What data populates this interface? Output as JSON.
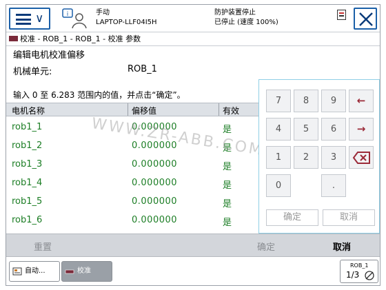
{
  "header": {
    "mode": "手动",
    "controller": "LAPTOP-LLF04I5H",
    "safety_status": "防护装置停止",
    "motor_status": "已停止 (速度 100%)"
  },
  "breadcrumb": "校准 - ROB_1 - ROB_1 - 校准 参数",
  "page": {
    "title": "编辑电机校准偏移",
    "mech_unit_label": "机械单元:",
    "mech_unit_value": "ROB_1",
    "instruction": "输入 0 至 6.283 范围内的值，并点击“确定”。"
  },
  "table": {
    "columns": [
      "电机名称",
      "偏移值",
      "有效"
    ],
    "rows": [
      {
        "name": "rob1_1",
        "offset": "0.000000",
        "valid": "是"
      },
      {
        "name": "rob1_2",
        "offset": "0.000000",
        "valid": "是"
      },
      {
        "name": "rob1_3",
        "offset": "0.000000",
        "valid": "是"
      },
      {
        "name": "rob1_4",
        "offset": "0.000000",
        "valid": "是"
      },
      {
        "name": "rob1_5",
        "offset": "0.000000",
        "valid": "是"
      },
      {
        "name": "rob1_6",
        "offset": "0.000000",
        "valid": "是"
      }
    ]
  },
  "keypad": {
    "keys": [
      "7",
      "8",
      "9",
      "4",
      "5",
      "6",
      "1",
      "2",
      "3",
      "0",
      "."
    ],
    "left_arrow": "←",
    "right_arrow": "→",
    "ok": "确定",
    "cancel": "取消"
  },
  "action_bar": {
    "reset": "重置",
    "ok": "确定",
    "cancel": "取消"
  },
  "taskbar": {
    "auto_task": "自动...",
    "calib_task": "校准",
    "quickset_unit": "ROB_1",
    "quickset_fraction": "1/3"
  },
  "watermark": "WWW.ZR-ABB.COM",
  "colors": {
    "value_green": "#1b7d24",
    "accent_blue": "#1a5fa8",
    "arrow_red": "#9b2a38"
  }
}
